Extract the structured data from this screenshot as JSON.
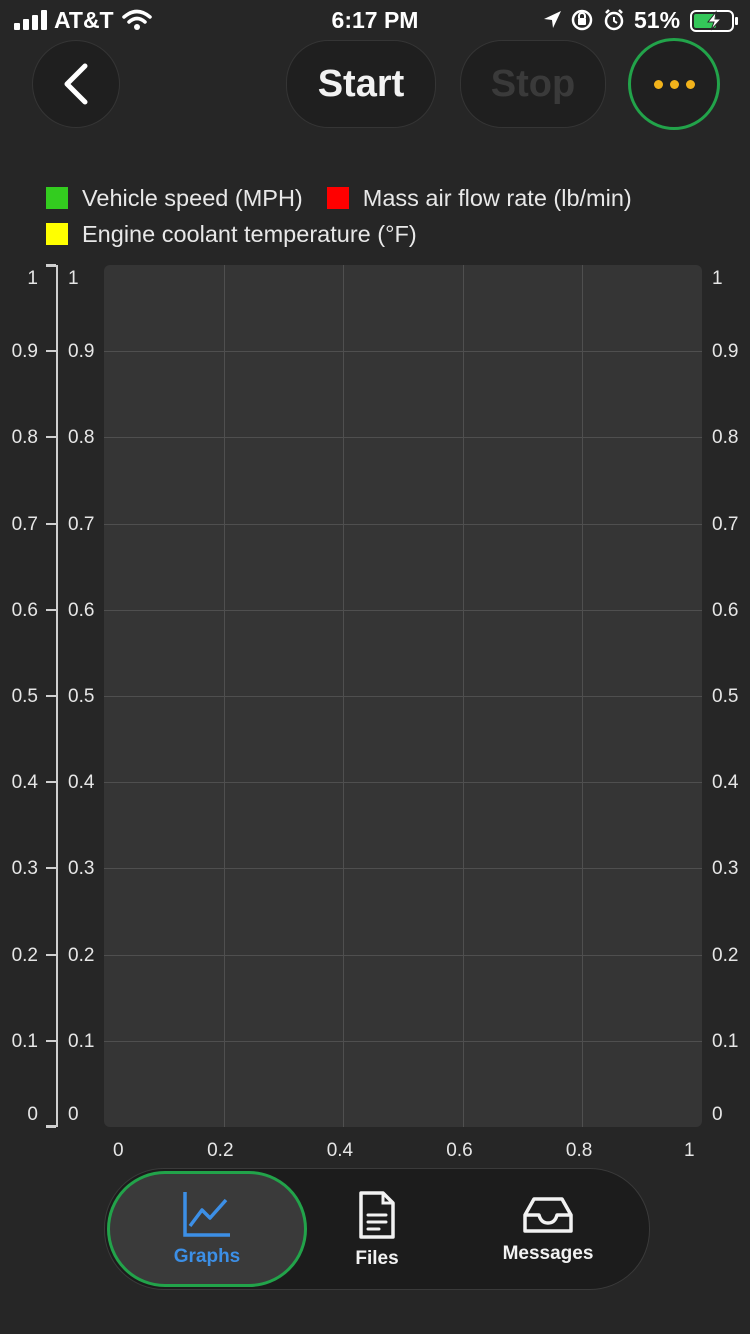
{
  "status_bar": {
    "carrier": "AT&T",
    "time": "6:17 PM",
    "battery_percent": "51%"
  },
  "toolbar": {
    "back_icon": "chevron-left-icon",
    "start_label": "Start",
    "stop_label": "Stop",
    "more_icon": "ellipsis-icon"
  },
  "legend": [
    {
      "label": "Vehicle speed (MPH)",
      "color": "#33cc1f"
    },
    {
      "label": "Mass air flow rate (lb/min)",
      "color": "#ff0000"
    },
    {
      "label": "Engine coolant temperature (°F)",
      "color": "#ffff00"
    }
  ],
  "chart_data": {
    "type": "line",
    "title": "",
    "xlabel": "",
    "ylabel": "",
    "x_ticks": [
      "0",
      "0.2",
      "0.4",
      "0.6",
      "0.8",
      "1"
    ],
    "y_ticks": [
      "0",
      "0.1",
      "0.2",
      "0.3",
      "0.4",
      "0.5",
      "0.6",
      "0.7",
      "0.8",
      "0.9",
      "1"
    ],
    "xlim": [
      0,
      1
    ],
    "ylim": [
      0,
      1
    ],
    "grid": true,
    "legend_position": "top",
    "series": [
      {
        "name": "Vehicle speed (MPH)",
        "values": []
      },
      {
        "name": "Mass air flow rate (lb/min)",
        "values": []
      },
      {
        "name": "Engine coolant temperature (°F)",
        "values": []
      }
    ]
  },
  "tabs": [
    {
      "label": "Graphs",
      "icon": "line-chart-icon",
      "active": true
    },
    {
      "label": "Files",
      "icon": "document-icon",
      "active": false
    },
    {
      "label": "Messages",
      "icon": "inbox-tray-icon",
      "active": false
    }
  ],
  "colors": {
    "accent": "#3c8fe6",
    "highlight_ring": "#22a34a",
    "menu_dots": "#f2b31b"
  }
}
